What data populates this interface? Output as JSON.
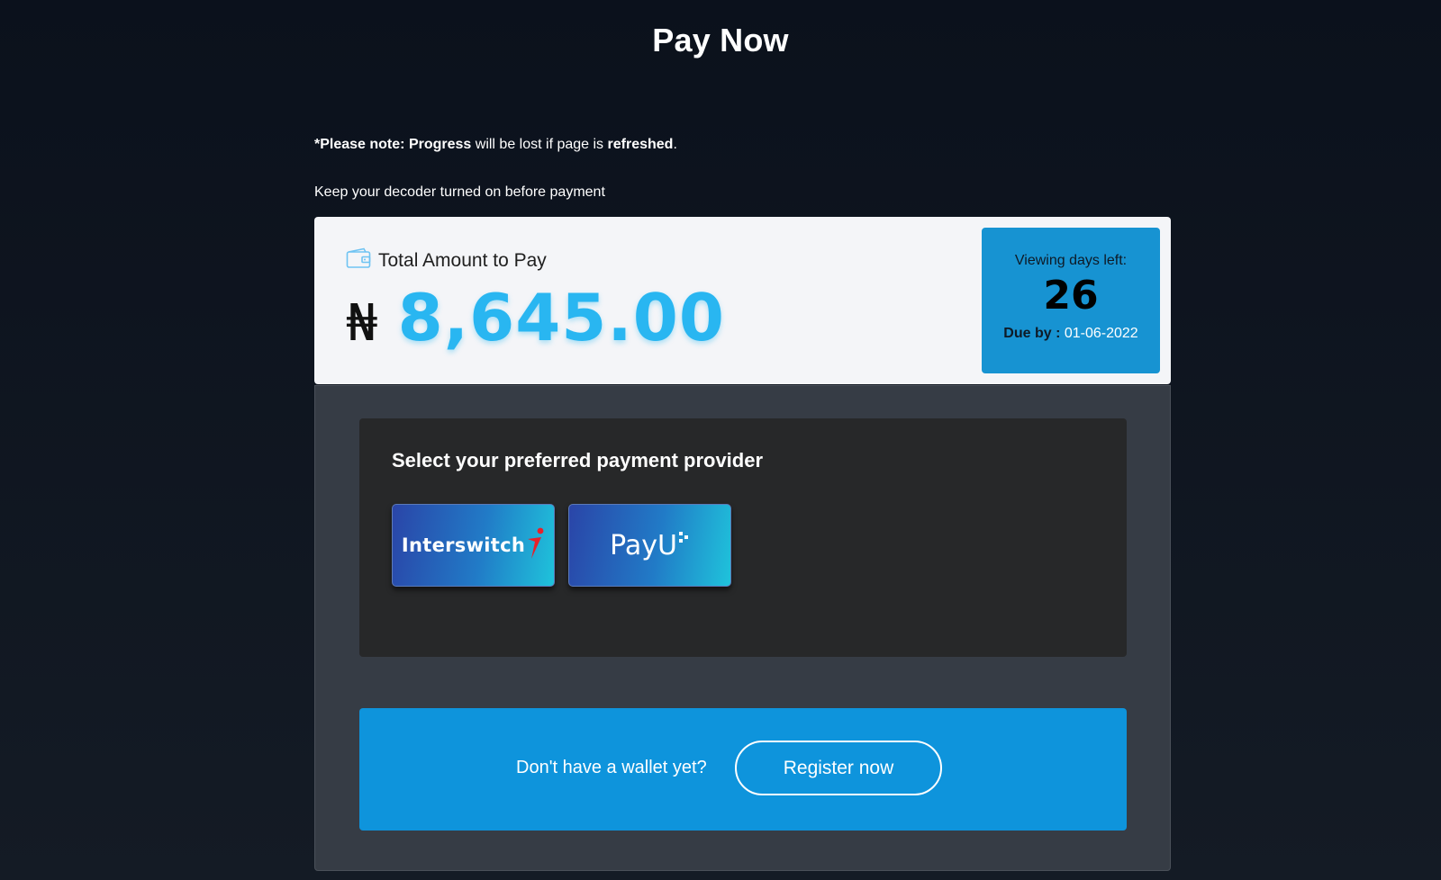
{
  "page": {
    "title": "Pay Now"
  },
  "notice": {
    "prefix": "*Please note:",
    "progress": "Progress",
    "middle": "will be lost if page is",
    "refreshed": "refreshed",
    "end": "."
  },
  "decoder_note": "Keep your decoder turned on before payment",
  "amount": {
    "label": "Total Amount to Pay",
    "currency_symbol": "₦",
    "value": "8,645.00",
    "icon": "wallet-icon"
  },
  "viewing": {
    "label": "Viewing days left:",
    "days": "26",
    "due_label": "Due by :",
    "due_date": "01-06-2022"
  },
  "providers": {
    "title": "Select your preferred payment provider",
    "items": [
      {
        "name": "Interswitch"
      },
      {
        "name": "PayU"
      }
    ]
  },
  "register": {
    "question": "Don't have a wallet yet?",
    "button_label": "Register now"
  },
  "colors": {
    "accent": "#29b6f1",
    "banner_blue": "#0e94dc",
    "days_box": "#1793d2"
  }
}
